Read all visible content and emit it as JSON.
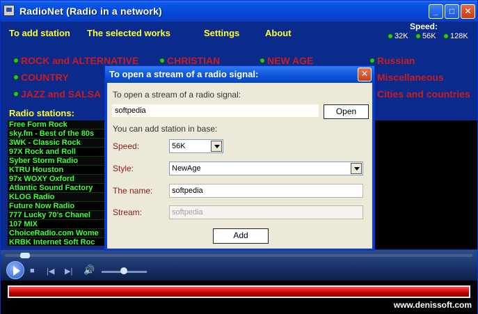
{
  "window": {
    "title": "RadioNet (Radio in a network)",
    "minimize_label": "_",
    "maximize_label": "□",
    "close_label": "✕"
  },
  "menu": {
    "add_station": "To add station",
    "selected_works": "The selected works",
    "settings": "Settings",
    "about": "About"
  },
  "speed": {
    "title": "Speed:",
    "options": [
      "32K",
      "56K",
      "128K"
    ]
  },
  "genres": [
    "ROCK and ALTERNATIVE",
    "CHRISTIAN",
    "NEW AGE",
    "Russian",
    "COUNTRY",
    "Miscellaneous",
    "JAZZ and SALSA",
    "Cities and countries"
  ],
  "stations": {
    "title": "Radio stations:",
    "items": [
      "Free Form Rock",
      "sky.fm - Best of the 80s",
      "3WK - Classic Rock",
      "97X Rock and Roll",
      "Syber Storm Radio",
      "KTRU Houston",
      "97x WOXY Oxford",
      "Atlantic Sound Factory",
      "KLOG Radio",
      "Future Now Radio",
      "777 Lucky 70's Chanel",
      "107 MIX",
      "ChoiceRadio.com Wome",
      "KRBK Internet Soft Roc"
    ]
  },
  "footer": {
    "site": "www.denissoft.com"
  },
  "dialog": {
    "title": "To open a stream of a radio signal:",
    "close_label": "✕",
    "open_heading": "To open a stream of a radio signal:",
    "stream_value": "softpedia",
    "open_button": "Open",
    "add_heading": "You can add station in base:",
    "speed_label": "Speed:",
    "speed_value": "56K",
    "style_label": "Style:",
    "style_value": "NewAge",
    "name_label": "The name:",
    "name_value": "softpedia",
    "stream_label": "Stream:",
    "stream_field_value": "softpedia",
    "add_button": "Add"
  }
}
